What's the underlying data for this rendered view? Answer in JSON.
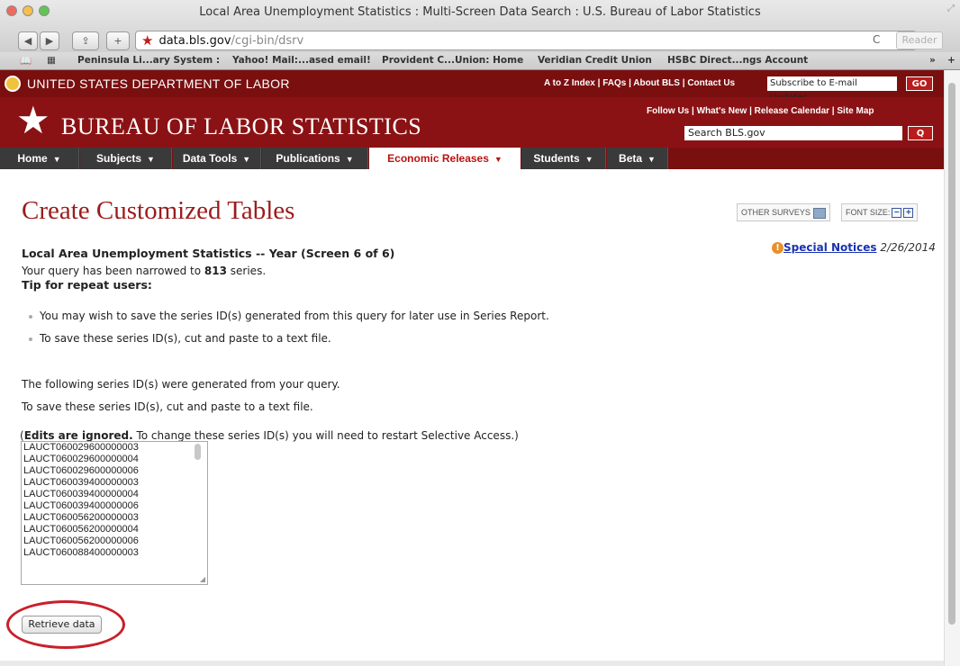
{
  "window": {
    "title": "Local Area Unemployment Statistics : Multi-Screen Data Search : U.S. Bureau of Labor Statistics"
  },
  "toolbar": {
    "back": "◀",
    "forward": "▶",
    "share": "⇪",
    "new_tab": "+",
    "url_host": "data.bls.gov",
    "url_path": "/cgi-bin/dsrv",
    "reload": "C",
    "reader": "Reader",
    "more": "»",
    "add": "+"
  },
  "bookmarks": [
    "Peninsula Li...ary System :",
    "Yahoo! Mail:...ased email!",
    "Provident C...Union: Home",
    "Veridian Credit Union",
    "HSBC Direct...ngs Account"
  ],
  "dol": {
    "name": "UNITED STATES DEPARTMENT OF LABOR",
    "links": "A to Z Index  |  FAQs  |  About BLS  |  Contact Us",
    "subscribe_placeholder": "Subscribe to E-mail Updates",
    "go": "GO"
  },
  "bls": {
    "name": "BUREAU OF LABOR STATISTICS",
    "follow": "Follow Us  |  What's New  |  Release Calendar  |  Site Map",
    "search_placeholder": "Search BLS.gov",
    "search_go": "Q"
  },
  "nav": [
    {
      "label": "Home"
    },
    {
      "label": "Subjects"
    },
    {
      "label": "Data Tools"
    },
    {
      "label": "Publications"
    },
    {
      "label": "Economic Releases"
    },
    {
      "label": "Students"
    },
    {
      "label": "Beta"
    }
  ],
  "page": {
    "title": "Create Customized Tables",
    "other_surveys": "OTHER SURVEYS",
    "font_size": "FONT SIZE:",
    "font_minus": "−",
    "font_plus": "+",
    "subtitle": "Local Area Unemployment Statistics -- Year (Screen 6 of 6)",
    "notice_label": "Special Notices",
    "notice_date": "2/26/2014",
    "narrowed_pre": "Your query has been narrowed to ",
    "narrowed_count": "813",
    "narrowed_post": " series.",
    "tip": "Tip for repeat users:",
    "bullets": [
      "You may wish to save the series ID(s) generated from this query for later use in Series Report.",
      "To save these series ID(s), cut and paste to a text file."
    ],
    "following1": "The following series ID(s) were generated from your query.",
    "following2": "To save these series ID(s), cut and paste to a text file.",
    "edits_bold": "Edits are ignored.",
    "edits_rest": " To change these series ID(s) you will need to restart Selective Access.)",
    "edits_open": "(",
    "series": [
      "LAUCT060029600000003",
      "LAUCT060029600000004",
      "LAUCT060029600000006",
      "LAUCT060039400000003",
      "LAUCT060039400000004",
      "LAUCT060039400000006",
      "LAUCT060056200000003",
      "LAUCT060056200000004",
      "LAUCT060056200000006",
      "LAUCT060088400000003"
    ],
    "retrieve": "Retrieve data"
  }
}
